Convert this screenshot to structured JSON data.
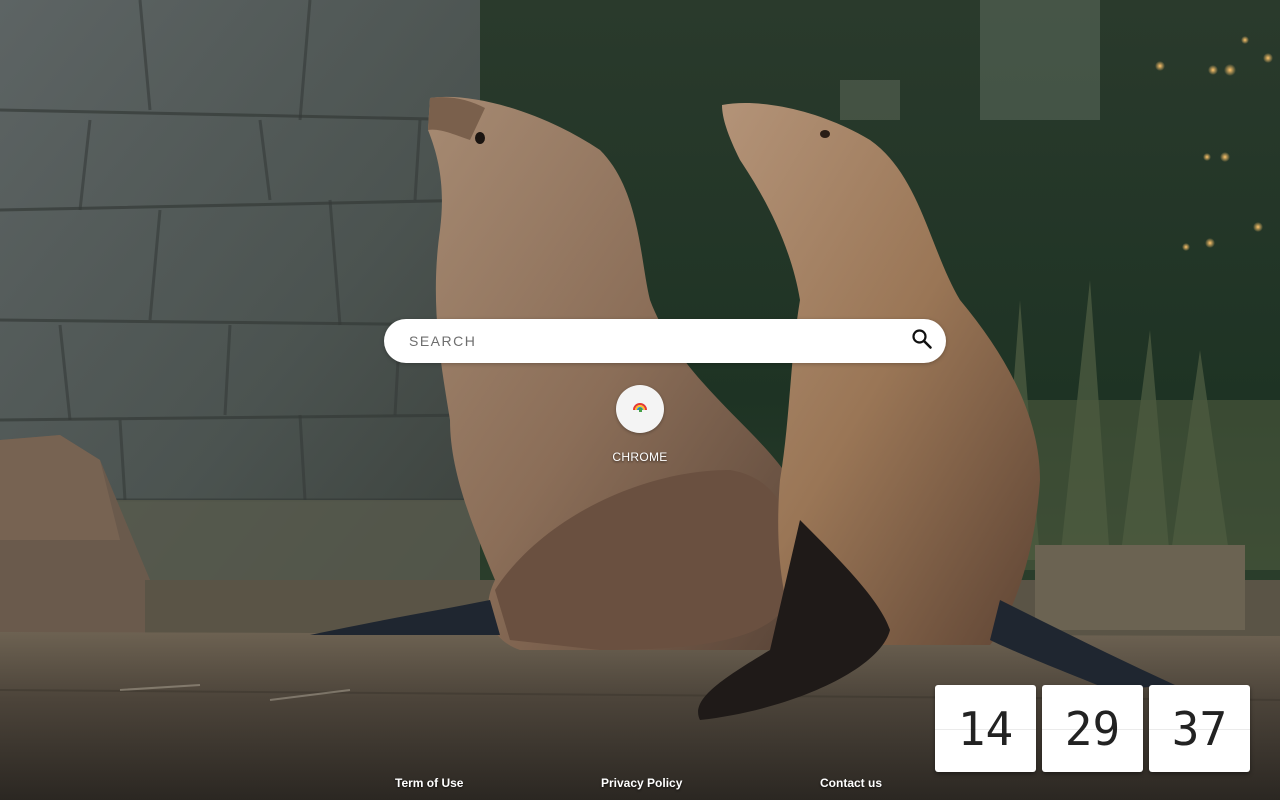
{
  "search": {
    "placeholder": "SEARCH",
    "icon": "search-icon"
  },
  "shortcuts": [
    {
      "label": "CHROME",
      "icon": "chrome-rainbow-icon"
    }
  ],
  "clock": {
    "hours": "14",
    "minutes": "29",
    "seconds": "37"
  },
  "footer": {
    "terms": "Term of Use",
    "privacy": "Privacy Policy",
    "contact": "Contact us"
  },
  "background": {
    "subject": "two sea lions on a rock ledge"
  }
}
